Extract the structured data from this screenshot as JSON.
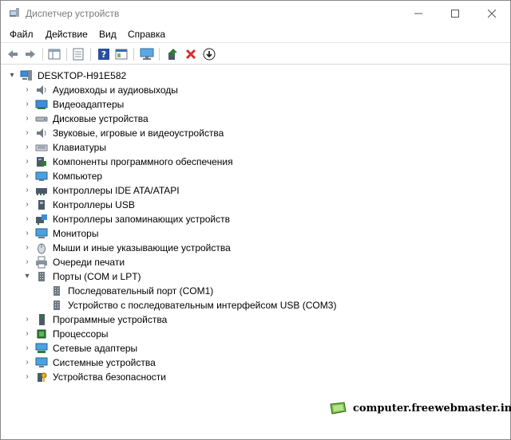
{
  "window": {
    "title": "Диспетчер устройств",
    "controls": {
      "minimize": "—",
      "maximize": "☐",
      "close": "✕"
    }
  },
  "menu": [
    "Файл",
    "Действие",
    "Вид",
    "Справка"
  ],
  "toolbar": {
    "buttons": [
      "back-icon",
      "forward-icon",
      "properties-icon",
      "view-icon",
      "help-icon",
      "properties-list-icon",
      "monitor-icon",
      "update-driver-icon",
      "remove-icon",
      "download-icon"
    ],
    "colors": {
      "remove": "#d32f2f",
      "update": "#2e7d32"
    }
  },
  "tree": {
    "root": "DESKTOP-H91E582",
    "categories": [
      {
        "label": "Аудиовходы и аудиовыходы",
        "icon": "speaker-icon",
        "expanded": false
      },
      {
        "label": "Видеоадаптеры",
        "icon": "display-adapter-icon",
        "expanded": false
      },
      {
        "label": "Дисковые устройства",
        "icon": "disk-icon",
        "expanded": false
      },
      {
        "label": "Звуковые, игровые и видеоустройства",
        "icon": "speaker-icon",
        "expanded": false
      },
      {
        "label": "Клавиатуры",
        "icon": "keyboard-icon",
        "expanded": false
      },
      {
        "label": "Компоненты программного обеспечения",
        "icon": "software-component-icon",
        "expanded": false
      },
      {
        "label": "Компьютер",
        "icon": "computer-icon",
        "expanded": false
      },
      {
        "label": "Контроллеры IDE ATA/ATAPI",
        "icon": "ide-controller-icon",
        "expanded": false
      },
      {
        "label": "Контроллеры USB",
        "icon": "usb-icon",
        "expanded": false
      },
      {
        "label": "Контроллеры запоминающих устройств",
        "icon": "storage-controller-icon",
        "expanded": false
      },
      {
        "label": "Мониторы",
        "icon": "monitor-icon",
        "expanded": false
      },
      {
        "label": "Мыши и иные указывающие устройства",
        "icon": "mouse-icon",
        "expanded": false
      },
      {
        "label": "Очереди печати",
        "icon": "printer-icon",
        "expanded": false
      },
      {
        "label": "Порты (COM и LPT)",
        "icon": "port-icon",
        "expanded": true,
        "children": [
          {
            "label": "Последовательный порт (COM1)",
            "icon": "port-icon"
          },
          {
            "label": "Устройство с последовательным интерфейсом USB (COM3)",
            "icon": "port-icon"
          }
        ]
      },
      {
        "label": "Программные устройства",
        "icon": "software-device-icon",
        "expanded": false
      },
      {
        "label": "Процессоры",
        "icon": "processor-icon",
        "expanded": false
      },
      {
        "label": "Сетевые адаптеры",
        "icon": "network-adapter-icon",
        "expanded": false
      },
      {
        "label": "Системные устройства",
        "icon": "system-device-icon",
        "expanded": false
      },
      {
        "label": "Устройства безопасности",
        "icon": "security-device-icon",
        "expanded": false
      }
    ]
  },
  "watermark": {
    "text": "computer.freewebmaster.info"
  }
}
